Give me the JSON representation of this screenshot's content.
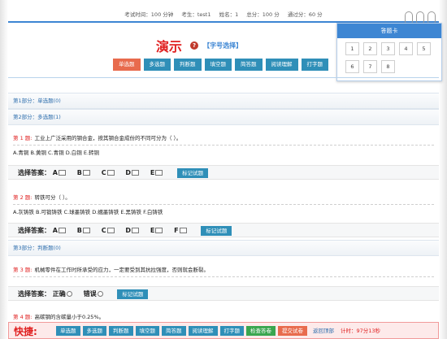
{
  "info_bar": {
    "exam_time": "考试时间：100 分钟",
    "examinee": "考生：test1",
    "name": "姓名：1",
    "total_score": "总分：100 分",
    "pass_score": "通过分：60 分"
  },
  "answer_card": {
    "title": "答题卡",
    "cells": [
      "1",
      "2",
      "3",
      "4",
      "5",
      "6",
      "7",
      "8"
    ]
  },
  "title": {
    "main": "演示",
    "help_icon": "?",
    "font_select": "【字号选择】"
  },
  "type_tabs": [
    "单选题",
    "多选题",
    "判断题",
    "填空题",
    "简答题",
    "阅读理解",
    "打字题"
  ],
  "sections": {
    "part1": "第1部分：单选题(0)",
    "part2": "第2部分：多选题(1)",
    "part3": "第3部分：判断题(0)"
  },
  "questions": [
    {
      "number": "第 1 题:",
      "stem": "工业上广泛采用的钢合金，按其钢合金成份的不同可分为（ ）。",
      "options": "A.青铜 B.黄铜 C.青铜 D.白铜 E.转铜"
    },
    {
      "number": "第 2 题:",
      "stem": "转铁可分（ ）。",
      "options": "A.灰铸铁 B.可锻铸铁 C.球墨铸铁 D.蠕墨铸铁 E.黑铸铁 F.白铸铁"
    },
    {
      "number": "第 3 题:",
      "stem": "机械零件在工作时所承受的应力，一定要受到其抗拉强度，否则就会断裂。"
    },
    {
      "number": "第 4 题:",
      "stem": "高碳钢的含碳量小于0.25%。"
    }
  ],
  "answer_bars": {
    "label": "选择答案：",
    "q1_options": [
      "A",
      "B",
      "C",
      "D",
      "E"
    ],
    "q2_options": [
      "A",
      "B",
      "C",
      "D",
      "E",
      "F"
    ],
    "q3_options": [
      "正确",
      "错误"
    ],
    "mark_label": "标记试题"
  },
  "quick_bar": {
    "label": "快捷:",
    "tabs": [
      "单选题",
      "多选题",
      "判断题",
      "填空题",
      "简答题",
      "阅读理解",
      "打字题"
    ],
    "check_answer": "检查答卷",
    "submit": "提交试卷",
    "back_top": "返回顶部",
    "timer": "计时：97分13秒"
  },
  "colors": {
    "primary_blue": "#3d86d3",
    "accent_red": "#e02020",
    "active_tab_orange": "#e86b4d",
    "tab_blue": "#2f8fb8",
    "check_green": "#3aa64f"
  }
}
